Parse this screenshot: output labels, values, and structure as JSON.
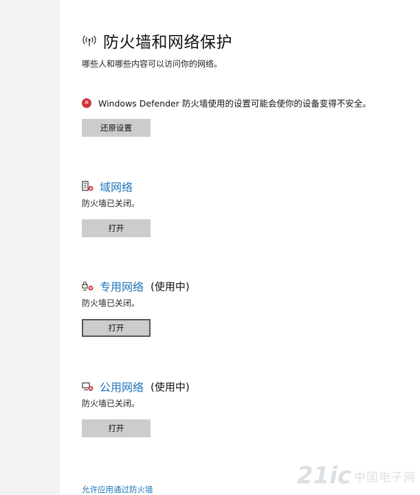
{
  "header": {
    "title": "防火墙和网络保护",
    "subtitle": "哪些人和哪些内容可以访问你的网络。"
  },
  "warning": {
    "text": "Windows Defender 防火墙使用的设置可能会使你的设备变得不安全。",
    "restore_button": "还原设置"
  },
  "networks": [
    {
      "name": "域网络",
      "suffix": "",
      "status": "防火墙已关闭。",
      "button": "打开",
      "icon": "domain-network-icon"
    },
    {
      "name": "专用网络",
      "suffix": "(使用中)",
      "status": "防火墙已关闭。",
      "button": "打开",
      "icon": "private-network-icon"
    },
    {
      "name": "公用网络",
      "suffix": "(使用中)",
      "status": "防火墙已关闭。",
      "button": "打开",
      "icon": "public-network-icon"
    }
  ],
  "links": {
    "allow_app": "允许应用通过防火墙"
  },
  "watermark": {
    "logo": "21ic",
    "text": "中国电子网"
  },
  "colors": {
    "link_blue": "#1e73b8",
    "error_red": "#d13438",
    "button_gray": "#cccccc"
  }
}
